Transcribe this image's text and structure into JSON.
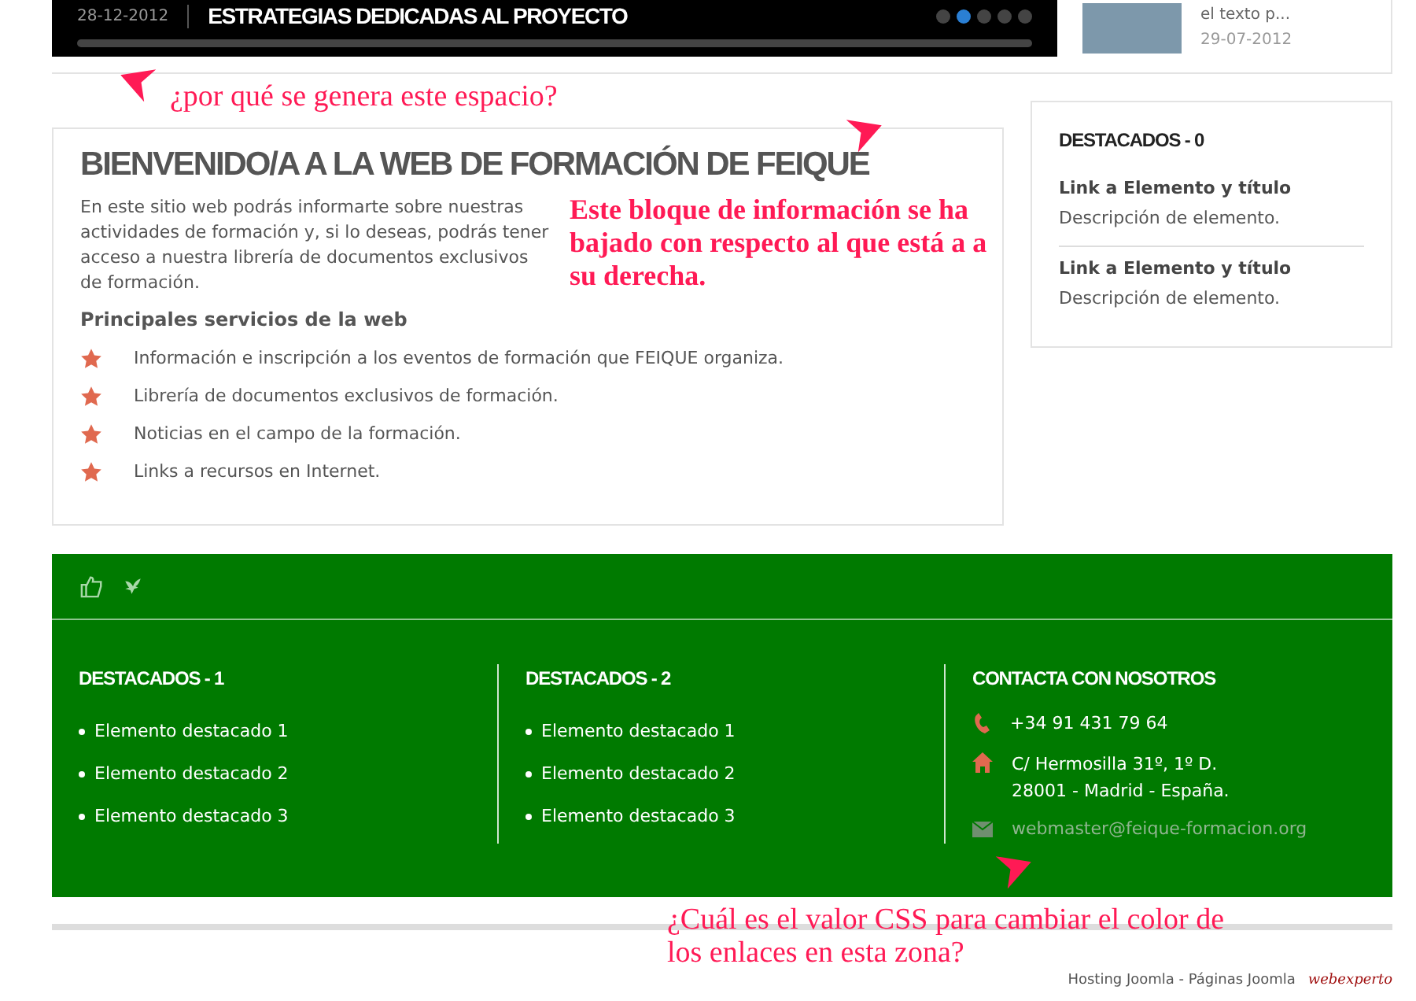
{
  "slider": {
    "progress": {
      "level": 0
    },
    "date": "28-12-2012",
    "title": "ESTRATEGIAS DEDICADAS AL PROYECTO",
    "dots": [
      {
        "selected": false
      },
      {
        "selected": true
      },
      {
        "selected": false
      },
      {
        "selected": false
      },
      {
        "selected": false
      }
    ]
  },
  "side_news": {
    "excerpt": "el texto p...",
    "date": "29-07-2012"
  },
  "welcome": {
    "title": "BIENVENIDO/A A LA WEB DE FORMACIÓN DE FEIQUE",
    "intro": "En este sitio web podrás informarte sobre nuestras actividades de formación y, si lo deseas, podrás tener acceso a nuestra librería de documentos exclusivos de formación.",
    "services_heading": "Principales servicios de la web",
    "services": [
      "Información e inscripción a los eventos de formación que FEIQUE organiza.",
      "Librería de documentos exclusivos de formación.",
      "Noticias en el campo de la formación.",
      "Links a recursos en Internet."
    ]
  },
  "featured_0": {
    "title": "DESTACADOS - 0",
    "items": [
      {
        "link": "Link a Elemento y título",
        "description": "Descripción de elemento."
      },
      {
        "link": "Link a Elemento y título",
        "description": "Descripción de elemento."
      }
    ]
  },
  "footer": {
    "columns": [
      {
        "title": "DESTACADOS - 1",
        "items": [
          "Elemento destacado 1",
          "Elemento destacado 2",
          "Elemento destacado 3"
        ]
      },
      {
        "title": "DESTACADOS - 2",
        "items": [
          "Elemento destacado 1",
          "Elemento destacado 2",
          "Elemento destacado 3"
        ]
      }
    ],
    "contact": {
      "title": "CONTACTA CON NOSOTROS",
      "phone": "+34 91 431 79 64",
      "address": [
        "C/ Hermosilla 31º, 1º D.",
        "28001 - Madrid - España."
      ],
      "email": "webmaster@feique-formacion.org"
    }
  },
  "credits": {
    "text": "Hosting Joomla - Páginas Joomla",
    "logo": "webexperto"
  },
  "annotations": [
    "¿por qué se genera este espacio?",
    "Este bloque de información se ha bajado con respecto al que está a a su derecha.",
    "¿Cuál es el valor CSS para cambiar el color de los enlaces en esta zona?"
  ]
}
